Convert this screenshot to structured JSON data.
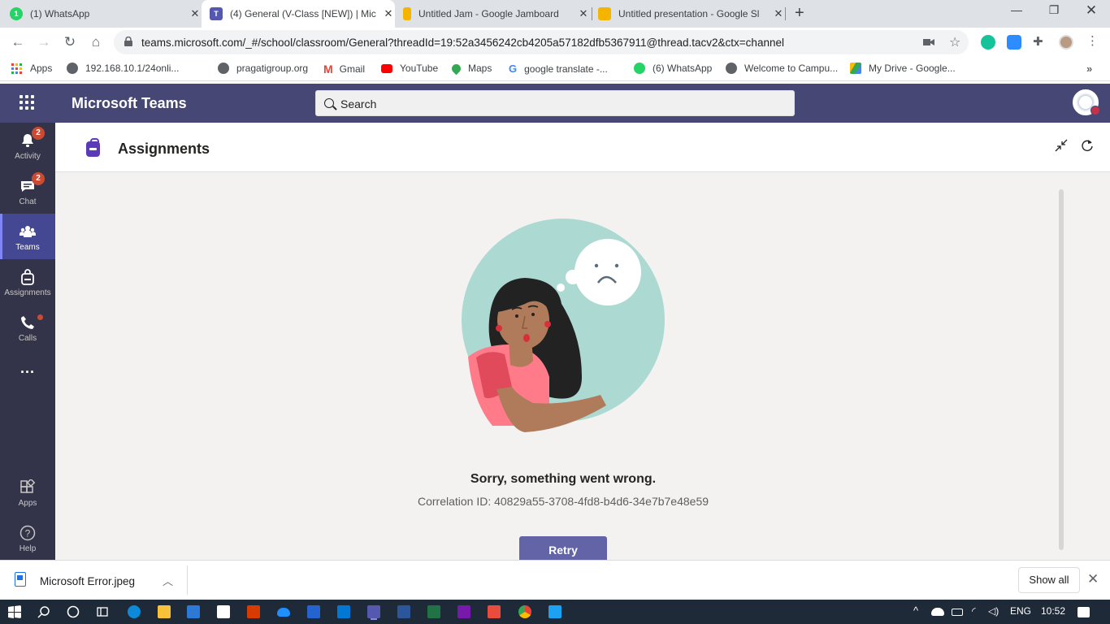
{
  "browser": {
    "tabs": [
      {
        "title": "(1) WhatsApp",
        "favicon": "whatsapp-icon",
        "color": "#25d366"
      },
      {
        "title": "(4) General (V-Class [NEW]) | Mic",
        "favicon": "teams-icon",
        "color": "#5558af"
      },
      {
        "title": "Untitled Jam - Google Jamboard",
        "favicon": "jamboard-icon",
        "color": "#f4b400"
      },
      {
        "title": "Untitled presentation - Google Sl",
        "favicon": "slides-icon",
        "color": "#f4b400"
      }
    ],
    "url": "teams.microsoft.com/_#/school/classroom/General?threadId=19:52a3456242cb4205a57182dfb5367911@thread.tacv2&ctx=channel",
    "bookmarks": [
      {
        "label": "Apps",
        "icon": "apps-grid-icon",
        "color": "#ea4335"
      },
      {
        "label": "192.168.10.1/24onli...",
        "icon": "globe-icon",
        "color": "#5f6368"
      },
      {
        "label": "pragatigroup.org",
        "icon": "globe-icon",
        "color": "#5f6368"
      },
      {
        "label": "Gmail",
        "icon": "gmail-icon",
        "color": "#ea4335"
      },
      {
        "label": "YouTube",
        "icon": "youtube-icon",
        "color": "#ff0000"
      },
      {
        "label": "Maps",
        "icon": "maps-icon",
        "color": "#34a853"
      },
      {
        "label": "google translate -...",
        "icon": "google-icon",
        "color": "#4285f4"
      },
      {
        "label": "(6) WhatsApp",
        "icon": "whatsapp-icon",
        "color": "#25d366"
      },
      {
        "label": "Welcome to Campu...",
        "icon": "globe-icon",
        "color": "#5f6368"
      },
      {
        "label": "My Drive - Google...",
        "icon": "drive-icon",
        "color": "#fbbc04"
      }
    ]
  },
  "teams": {
    "app_name": "Microsoft Teams",
    "search_placeholder": "Search",
    "rail": [
      {
        "label": "Activity",
        "badge": "2"
      },
      {
        "label": "Chat",
        "badge": "2"
      },
      {
        "label": "Teams",
        "badge": ""
      },
      {
        "label": "Assignments",
        "badge": ""
      },
      {
        "label": "Calls",
        "badge": ""
      },
      {
        "label": "Apps",
        "badge": ""
      },
      {
        "label": "Help",
        "badge": ""
      }
    ],
    "more_label": "...",
    "pane_title": "Assignments",
    "error_message": "Sorry, something went wrong.",
    "correlation": "Correlation ID: 40829a55-3708-4fd8-b4d6-34e7b7e48e59",
    "retry_label": "Retry",
    "accent": "#464775"
  },
  "download": {
    "file": "Microsoft Error.jpeg",
    "show_all": "Show all"
  },
  "taskbar": {
    "lang": "ENG",
    "time": "10:52"
  }
}
